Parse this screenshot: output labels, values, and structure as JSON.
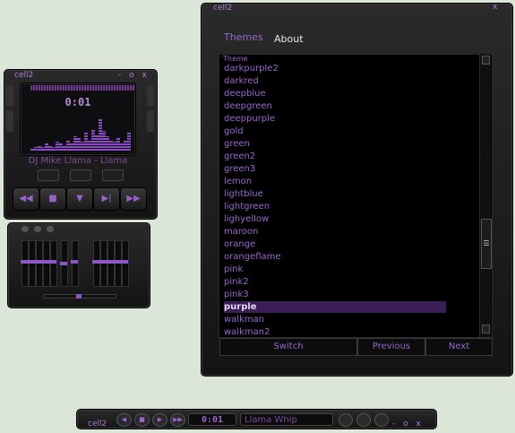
{
  "player": {
    "title": "cell2",
    "window_controls": "- o x",
    "time": "0:01",
    "song": "DJ Mike Llama - Llama",
    "visualizer_levels": [
      0.05,
      0.1,
      0.15,
      0.1,
      0.2,
      0.15,
      0.1,
      0.25,
      0.2,
      0.15,
      0.3,
      0.2,
      0.4,
      0.35,
      0.25,
      0.5,
      0.3,
      0.6,
      0.45,
      0.9,
      0.55,
      0.4,
      0.3,
      0.25,
      0.35,
      0.2,
      0.3,
      0.5
    ],
    "transport": [
      {
        "name": "previous",
        "glyph": "◀◀"
      },
      {
        "name": "stop",
        "glyph": "■"
      },
      {
        "name": "open",
        "glyph": "▼"
      },
      {
        "name": "next",
        "glyph": "▶|"
      },
      {
        "name": "forward",
        "glyph": "▶▶"
      }
    ],
    "eq_levels": [
      0.55,
      0.55,
      0.55,
      0.55,
      0.55,
      0.5,
      0.55,
      0.55,
      0.55,
      0.55,
      0.55,
      0.55
    ]
  },
  "themes_window": {
    "title": "cell2",
    "close": "x",
    "tabs": [
      "Themes",
      "About"
    ],
    "list_label": "Theme",
    "items": [
      "darkpurple2",
      "darkred",
      "deepblue",
      "deepgreen",
      "deeppurple",
      "gold",
      "green",
      "green2",
      "green3",
      "lemon",
      "lightblue",
      "lightgreen",
      "lighyellow",
      "maroon",
      "orange",
      "orangeflame",
      "pink",
      "pink2",
      "pink3",
      "purple",
      "walkman",
      "walkman2"
    ],
    "selected": "purple",
    "buttons": [
      "Switch",
      "Previous",
      "Next"
    ],
    "scroll_glyph": "☰"
  },
  "mini": {
    "title": "cell2",
    "time": "0:01",
    "song": "Llama Whip",
    "window_controls": "- o x"
  },
  "colors": {
    "accent": "#9a66d0",
    "selection": "#3c1e56",
    "chrome": "#1c1c1c"
  }
}
